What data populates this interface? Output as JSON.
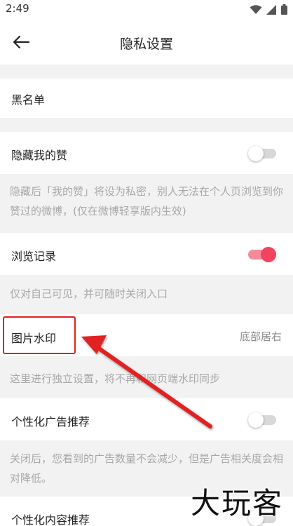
{
  "status": {
    "time": "2:49"
  },
  "header": {
    "title": "隐私设置"
  },
  "rows": {
    "blacklist": {
      "label": "黑名单"
    },
    "hide_likes": {
      "label": "隐藏我的赞",
      "on": false
    },
    "browse_history": {
      "label": "浏览记录",
      "on": true
    },
    "watermark": {
      "label": "图片水印",
      "value": "底部居右"
    },
    "personal_ads": {
      "label": "个性化广告推荐",
      "on": false
    },
    "personal_content": {
      "label": "个性化内容推荐",
      "on": false
    }
  },
  "notes": {
    "hide_likes": "隐藏后「我的赞」将设为私密，别人无法在个人页浏览到你赞过的微博，(仅在微博轻享版内生效)",
    "browse_history": "仅对自己可见，并可随时关闭入口",
    "watermark": "这里进行独立设置，将不再和网页端水印同步",
    "personal_ads": "关闭后，您看到的广告数量不会减少，但是广告相关度会相对降低。"
  },
  "overlay": {
    "watermark_text": "大玩客"
  },
  "colors": {
    "accent": "#f3445f",
    "annotation": "#e02020"
  },
  "icons": [
    "wifi-icon",
    "signal-icon",
    "battery-icon",
    "back-arrow-icon"
  ]
}
